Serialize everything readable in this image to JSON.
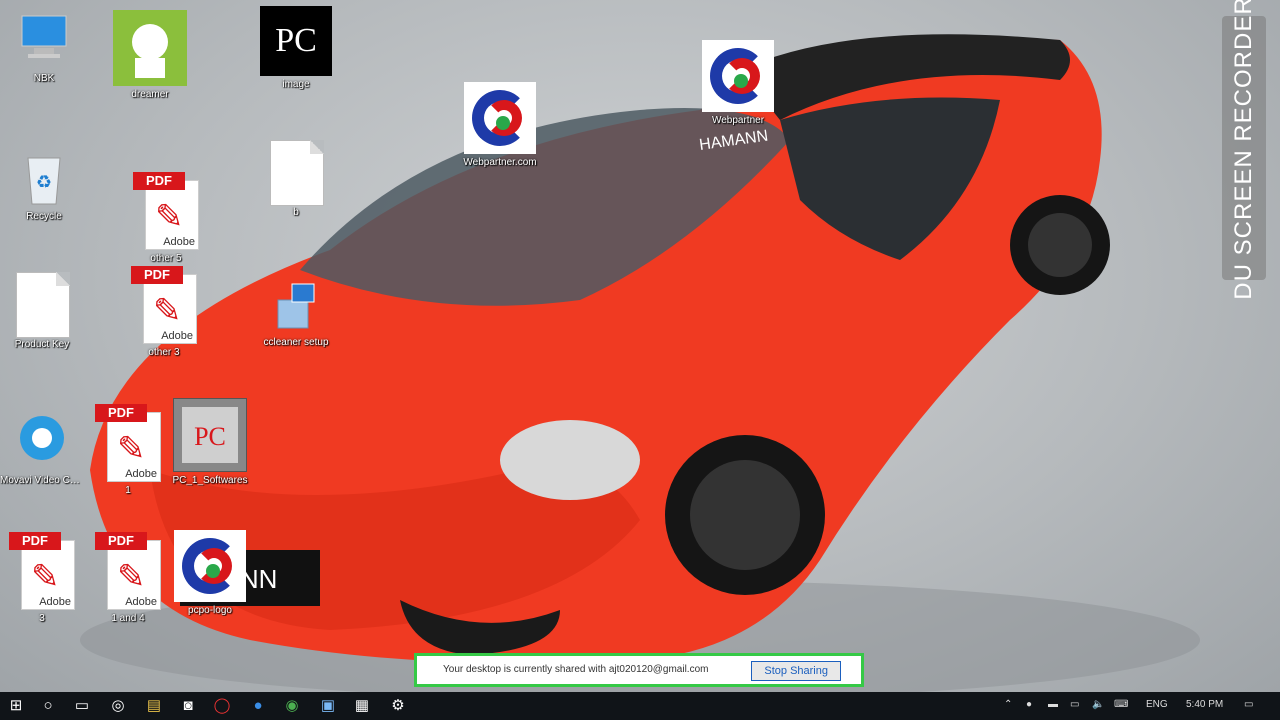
{
  "desktop": {
    "icons": [
      {
        "label": "NBK"
      },
      {
        "label": "dreamer"
      },
      {
        "label": "image"
      },
      {
        "label": "Recycle"
      },
      {
        "label": "other 5"
      },
      {
        "label": "b"
      },
      {
        "label": "Product Key"
      },
      {
        "label": "other 3"
      },
      {
        "label": "ccleaner setup"
      },
      {
        "label": "Movavi Video Converter Ultimate"
      },
      {
        "label": "1"
      },
      {
        "label": "PC_1_Softwares"
      },
      {
        "label": "3"
      },
      {
        "label": "1 and 4"
      },
      {
        "label": "pcpo-logo"
      },
      {
        "label": "Webpartner.com"
      },
      {
        "label": "Webpartner"
      }
    ]
  },
  "recorder": {
    "label": "DU SCREEN RECORDER"
  },
  "share_bar": {
    "message": "Your desktop is currently shared with ajt020120@gmail.com",
    "stop_label": "Stop Sharing"
  },
  "taskbar": {
    "language": "ENG",
    "time": "5:40 PM"
  },
  "colors": {
    "accent_green": "#35c946",
    "pdf_red": "#d8171b",
    "ccp_blue": "#1e3aa8"
  }
}
